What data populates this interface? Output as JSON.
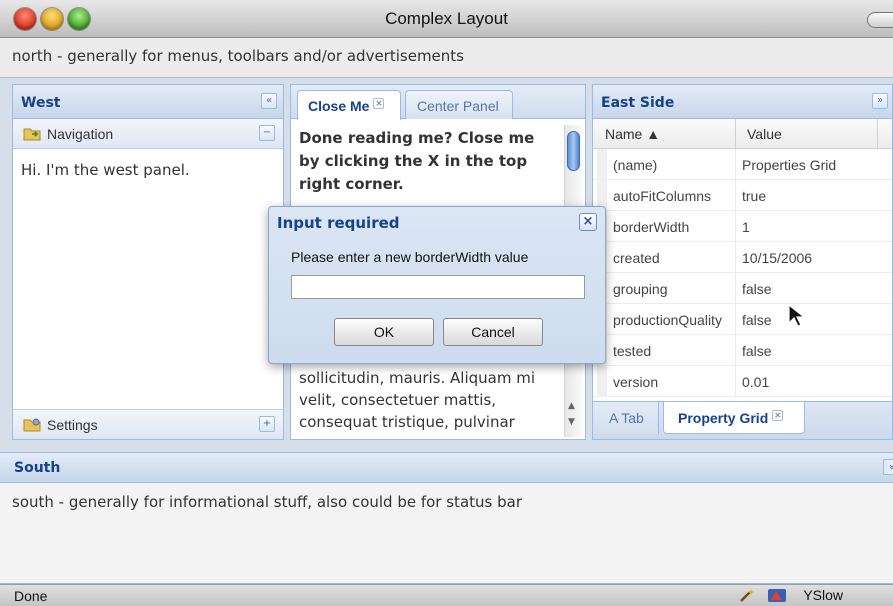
{
  "window": {
    "title": "Complex Layout"
  },
  "north": {
    "text": "north - generally for menus, toolbars and/or advertisements"
  },
  "west": {
    "title": "West",
    "collapse_glyph": "«",
    "navigation_label": "Navigation",
    "navigation_toggle": "−",
    "body_text": "Hi. I'm the west panel.",
    "settings_label": "Settings",
    "settings_toggle": "+"
  },
  "center": {
    "tabs": [
      {
        "label": "Close Me",
        "active": true,
        "closable": true
      },
      {
        "label": "Center Panel",
        "active": false
      }
    ],
    "bold_text": "Done reading me? Close me by clicking the X in the top right corner.",
    "body_text": "sollicitudin, mauris. Aliquam mi velit, consectetuer mattis, consequat tristique, pulvinar"
  },
  "east": {
    "title": "East Side",
    "collapse_glyph": "»",
    "columns": {
      "name": "Name ▲",
      "value": "Value"
    },
    "rows": [
      {
        "name": "(name)",
        "value": "Properties Grid"
      },
      {
        "name": "autoFitColumns",
        "value": "true"
      },
      {
        "name": "borderWidth",
        "value": "1"
      },
      {
        "name": "created",
        "value": "10/15/2006"
      },
      {
        "name": "grouping",
        "value": "false"
      },
      {
        "name": "productionQuality",
        "value": "false"
      },
      {
        "name": "tested",
        "value": "false"
      },
      {
        "name": "version",
        "value": "0.01"
      }
    ],
    "bottom_tabs": [
      {
        "label": "A Tab",
        "active": false
      },
      {
        "label": "Property Grid",
        "active": true,
        "closable": true
      }
    ]
  },
  "south": {
    "title": "South",
    "collapse_glyph": "»",
    "text": "south - generally for informational stuff, also could be for status bar"
  },
  "dialog": {
    "title": "Input required",
    "close_glyph": "×",
    "message": "Please enter a new borderWidth value",
    "input_value": "",
    "ok_label": "OK",
    "cancel_label": "Cancel"
  },
  "statusbar": {
    "text": "Done",
    "yslow_label": "YSlow"
  },
  "colors": {
    "panel_header_text": "#15428b",
    "panel_border": "#99bbe8",
    "frame_bg": "#d6dfe9"
  }
}
